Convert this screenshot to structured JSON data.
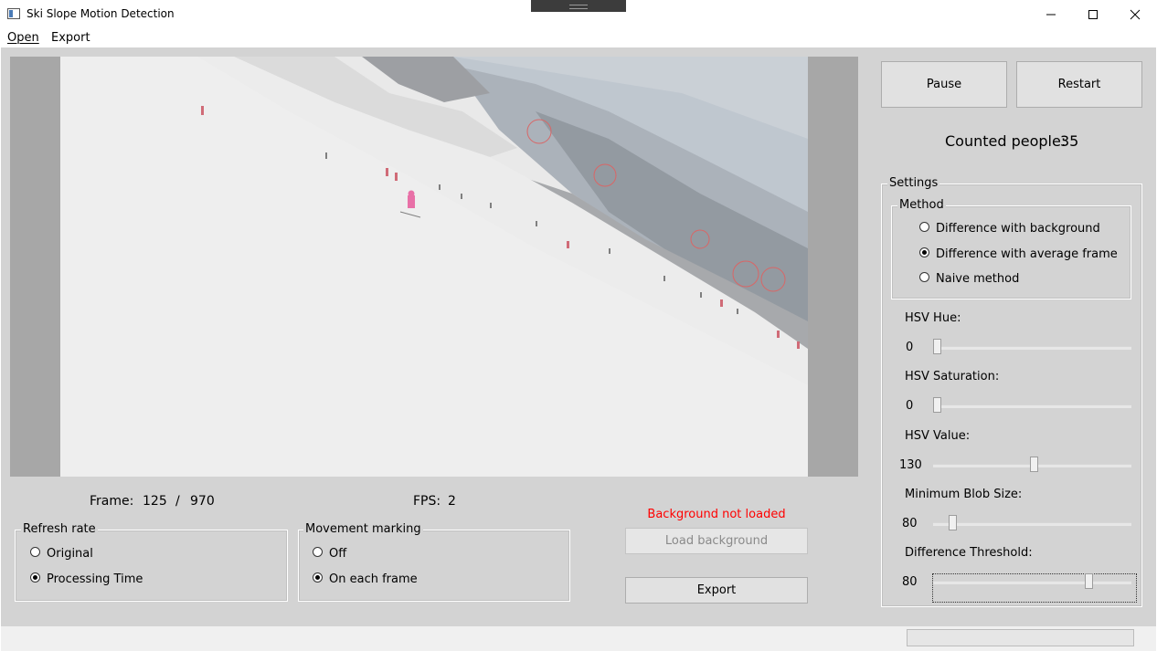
{
  "window": {
    "title": "Ski Slope Motion Detection"
  },
  "menu": {
    "items": [
      "Open",
      "Export"
    ]
  },
  "controls": {
    "pause_label": "Pause",
    "restart_label": "Restart"
  },
  "counter": {
    "label": "Counted people:",
    "value": "35"
  },
  "frame": {
    "label": "Frame:",
    "current": "125",
    "separator": "/",
    "total": "970"
  },
  "fps": {
    "label": "FPS:",
    "value": "2"
  },
  "background": {
    "status": "Background not loaded",
    "load_label": "Load background",
    "status_color": "#ff0000"
  },
  "export": {
    "label": "Export"
  },
  "refresh_rate": {
    "title": "Refresh rate",
    "options": [
      "Original",
      "Processing Time"
    ],
    "selected": 1
  },
  "movement_marking": {
    "title": "Movement marking",
    "options": [
      "Off",
      "On each frame"
    ],
    "selected": 1
  },
  "settings": {
    "title": "Settings",
    "method": {
      "title": "Method",
      "options": [
        "Difference with background",
        "Difference with average frame",
        "Naive method"
      ],
      "selected": 1
    },
    "sliders": [
      {
        "label": "HSV Hue:",
        "value": "0",
        "fraction": 0.0
      },
      {
        "label": "HSV Saturation:",
        "value": "0",
        "fraction": 0.0
      },
      {
        "label": "HSV Value:",
        "value": "130",
        "fraction": 0.51
      },
      {
        "label": "Minimum Blob Size:",
        "value": "80",
        "fraction": 0.08
      },
      {
        "label": "Difference Threshold:",
        "value": "80",
        "fraction": 0.8
      }
    ]
  }
}
